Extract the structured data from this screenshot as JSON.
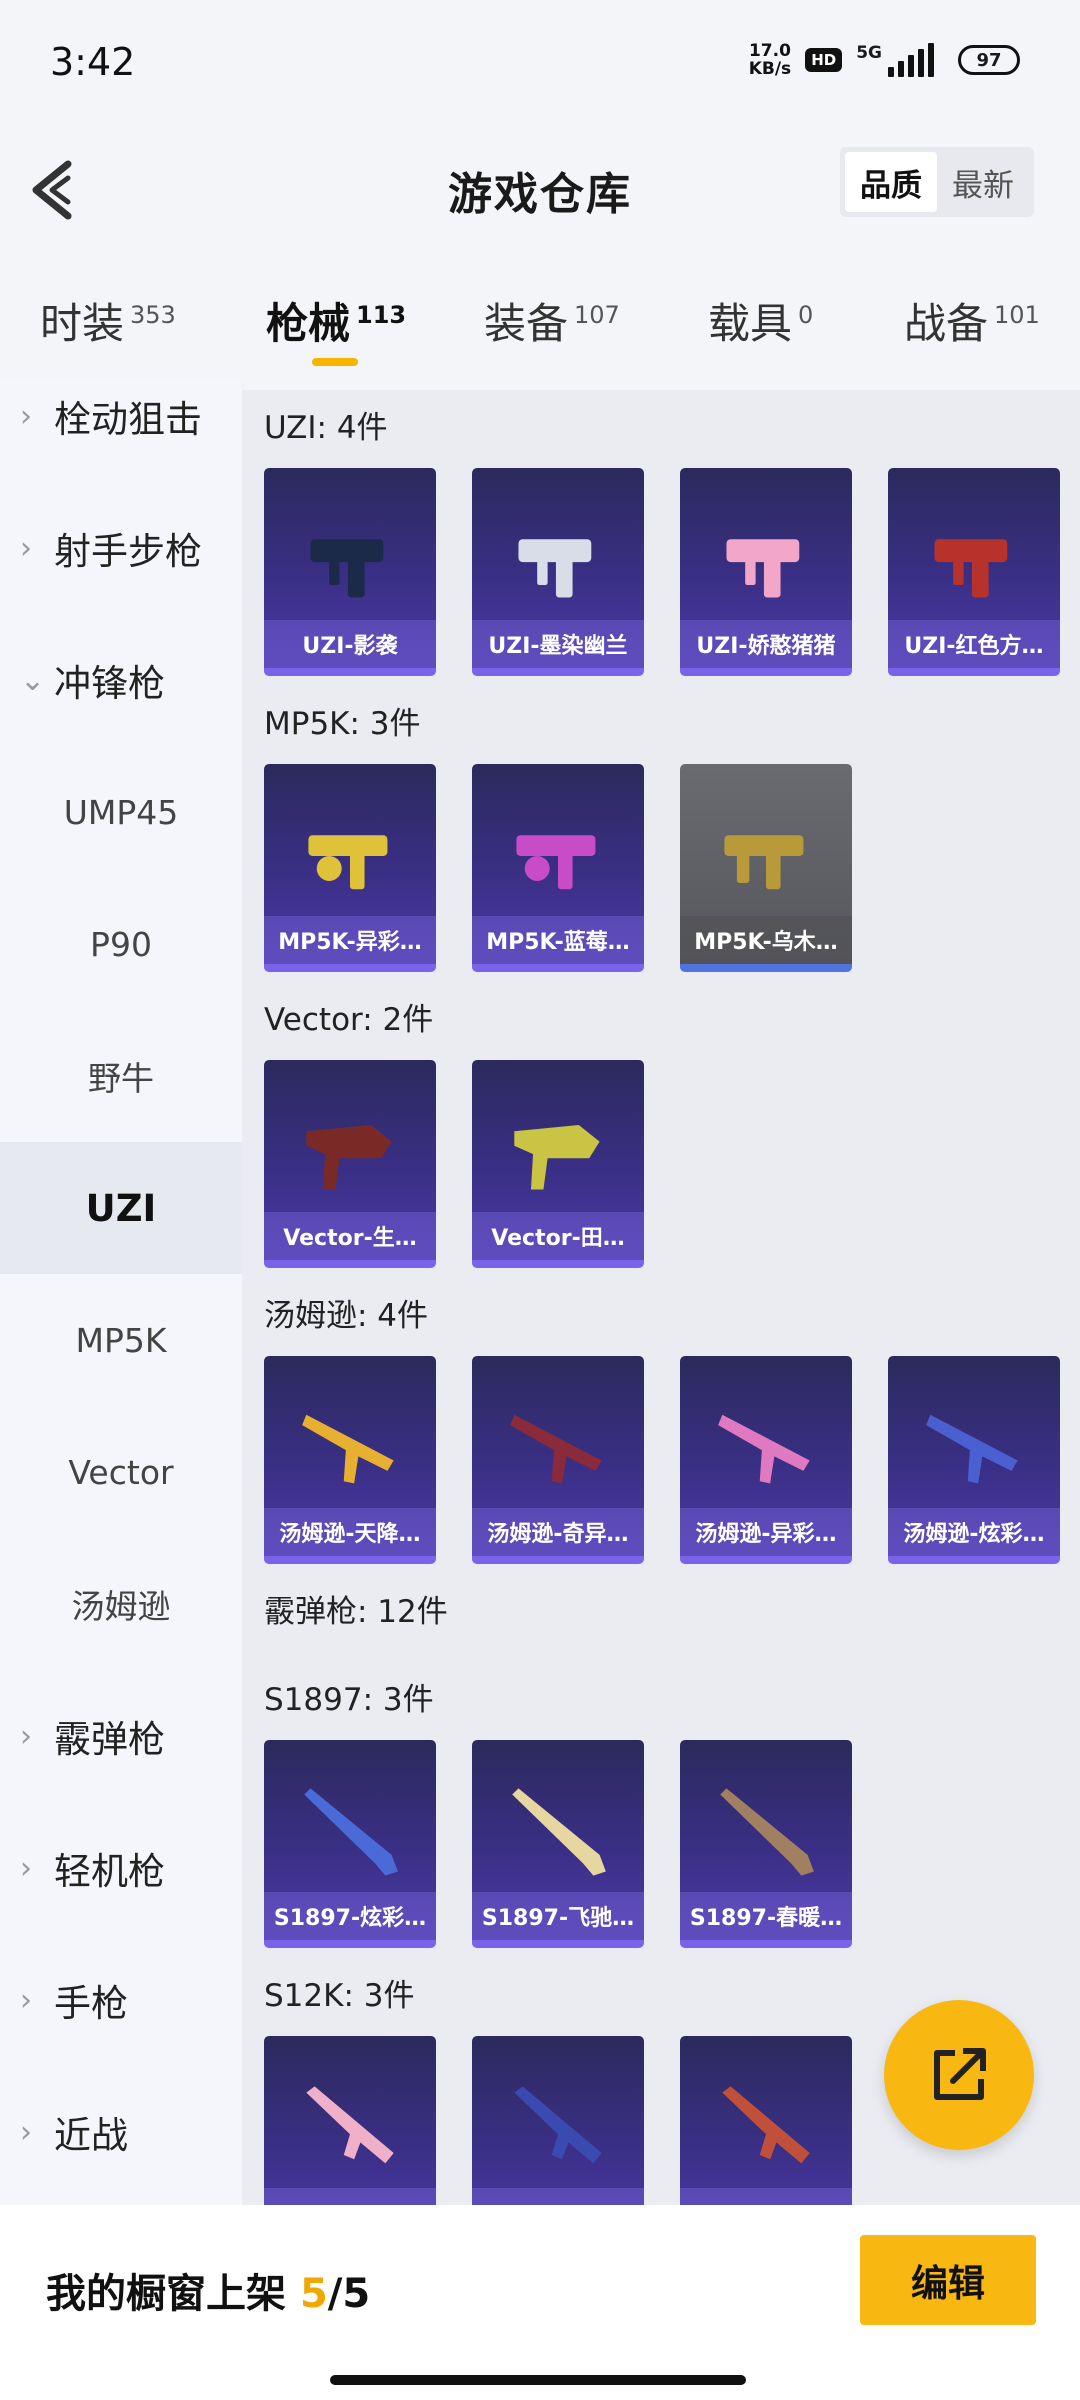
{
  "status_bar": {
    "time": "3:42",
    "net_speed_value": "17.0",
    "net_speed_unit": "KB/s",
    "hd": "HD",
    "network": "5G",
    "battery": "97"
  },
  "header": {
    "title": "游戏仓库",
    "sort_options": [
      "品质",
      "最新"
    ],
    "sort_active": "品质"
  },
  "tabs": [
    {
      "label": "时装",
      "count": "353"
    },
    {
      "label": "枪械",
      "count": "113"
    },
    {
      "label": "装备",
      "count": "107"
    },
    {
      "label": "载具",
      "count": "0"
    },
    {
      "label": "战备",
      "count": "101"
    }
  ],
  "active_tab": "枪械",
  "sidebar": {
    "items": [
      {
        "label": "栓动狙击",
        "type": "category",
        "expanded": false
      },
      {
        "label": "射手步枪",
        "type": "category",
        "expanded": false
      },
      {
        "label": "冲锋枪",
        "type": "category",
        "expanded": true
      },
      {
        "label": "UMP45",
        "type": "sub"
      },
      {
        "label": "P90",
        "type": "sub"
      },
      {
        "label": "野牛",
        "type": "sub"
      },
      {
        "label": "UZI",
        "type": "sub",
        "selected": true
      },
      {
        "label": "MP5K",
        "type": "sub"
      },
      {
        "label": "Vector",
        "type": "sub"
      },
      {
        "label": "汤姆逊",
        "type": "sub"
      },
      {
        "label": "霰弹枪",
        "type": "category",
        "expanded": false
      },
      {
        "label": "轻机枪",
        "type": "category",
        "expanded": false
      },
      {
        "label": "手枪",
        "type": "category",
        "expanded": false
      },
      {
        "label": "近战",
        "type": "category",
        "expanded": false
      }
    ]
  },
  "groups": [
    {
      "title": "UZI: 4件",
      "items": [
        "UZI-影袭",
        "UZI-墨染幽兰",
        "UZI-娇憨猪猪",
        "UZI-红色方…"
      ]
    },
    {
      "title": "MP5K: 3件",
      "items": [
        "MP5K-异彩…",
        "MP5K-蓝莓…",
        "MP5K-乌木…"
      ]
    },
    {
      "title": "Vector: 2件",
      "items": [
        "Vector-生…",
        "Vector-田…"
      ]
    },
    {
      "title": "汤姆逊: 4件",
      "items": [
        "汤姆逊-天降…",
        "汤姆逊-奇异…",
        "汤姆逊-异彩…",
        "汤姆逊-炫彩…"
      ]
    },
    {
      "title": "霰弹枪: 12件",
      "items": []
    },
    {
      "title": "S1897: 3件",
      "items": [
        "S1897-炫彩…",
        "S1897-飞驰…",
        "S1897-春暖…"
      ]
    },
    {
      "title": "S12K: 3件",
      "items": [
        "",
        "",
        ""
      ]
    }
  ],
  "gun_colors": {
    "uzi_1": "#1c2a4a",
    "uzi_2": "#d8dde8",
    "uzi_3": "#f2a6c8",
    "uzi_4": "#b8322c",
    "mp5k_1": "#e0c23a",
    "mp5k_2": "#c84bc8",
    "mp5k_3": "#b89a3a",
    "vec_1": "#7a2a26",
    "vec_2": "#c9c444",
    "tom_1": "#e8b030",
    "tom_2": "#8a2a3a",
    "tom_3": "#e07ac0",
    "tom_4": "#4a5fd0",
    "s1897_1": "#4a6ad8",
    "s1897_2": "#e6d6a0",
    "s1897_3": "#a08060",
    "s12k_1": "#f0b0c8",
    "s12k_2": "#3a4ab0",
    "s12k_3": "#c0503a"
  },
  "showcase": {
    "label": "我的橱窗上架",
    "current": "5",
    "total": "/5",
    "edit_label": "编辑"
  }
}
